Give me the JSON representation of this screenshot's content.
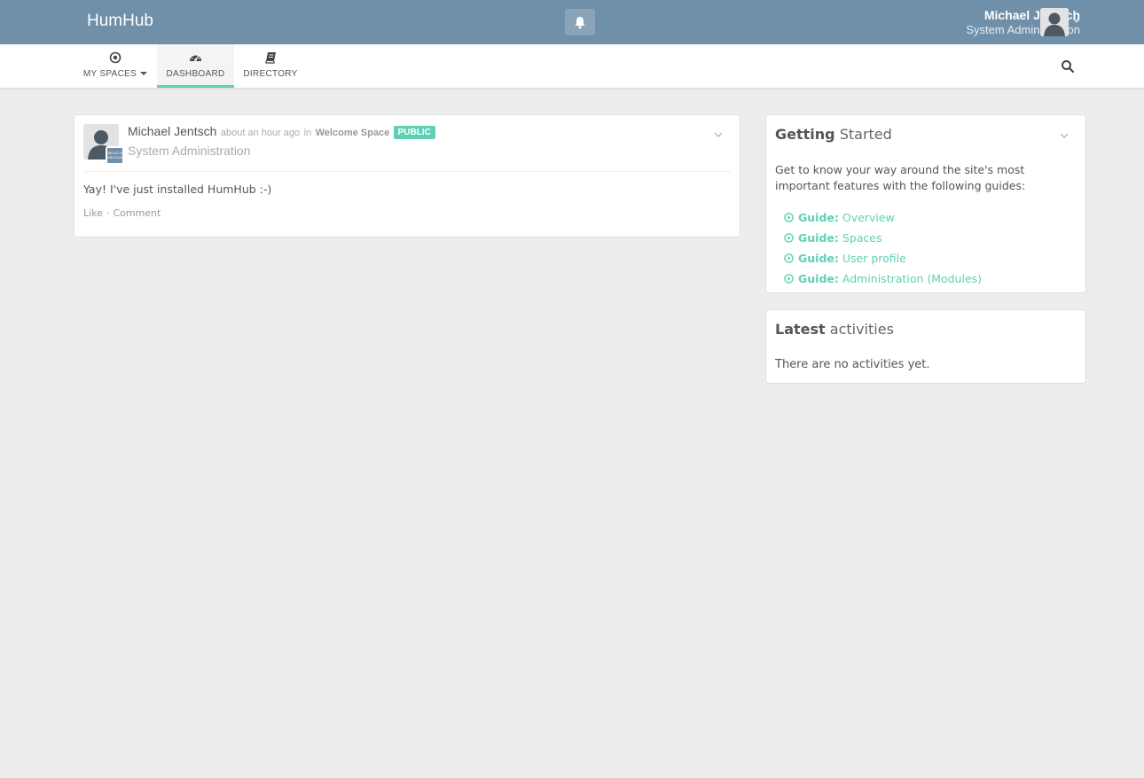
{
  "topbar": {
    "brand": "HumHub",
    "user": {
      "name": "Michael Jentsch",
      "title": "System Administration"
    }
  },
  "nav": {
    "items": [
      {
        "label": "MY SPACES",
        "icon": "circle-dot-icon"
      },
      {
        "label": "DASHBOARD",
        "icon": "dashboard-icon",
        "active": true
      },
      {
        "label": "DIRECTORY",
        "icon": "book-icon"
      }
    ]
  },
  "post": {
    "author": "Michael Jentsch",
    "time": "about an hour ago",
    "in_word": "in",
    "space": "Welcome Space",
    "visibility": "PUBLIC",
    "subtitle": "System Administration",
    "space_badge_text": "HELLO & WELCOME",
    "body": "Yay! I've just installed HumHub :-)",
    "like_label": "Like",
    "comment_label": "Comment",
    "separator": "·"
  },
  "getting_started": {
    "title_bold": "Getting",
    "title_light": "Started",
    "intro": "Get to know your way around the site's most important features with the following guides:",
    "guide_prefix": "Guide:",
    "guides": [
      "Overview",
      "Spaces",
      "User profile",
      "Administration (Modules)"
    ]
  },
  "latest_activities": {
    "title_bold": "Latest",
    "title_light": "activities",
    "empty_text": "There are no activities yet."
  },
  "colors": {
    "header_bg": "#708fa8",
    "accent": "#5fd0b5",
    "page_bg": "#ededed"
  }
}
